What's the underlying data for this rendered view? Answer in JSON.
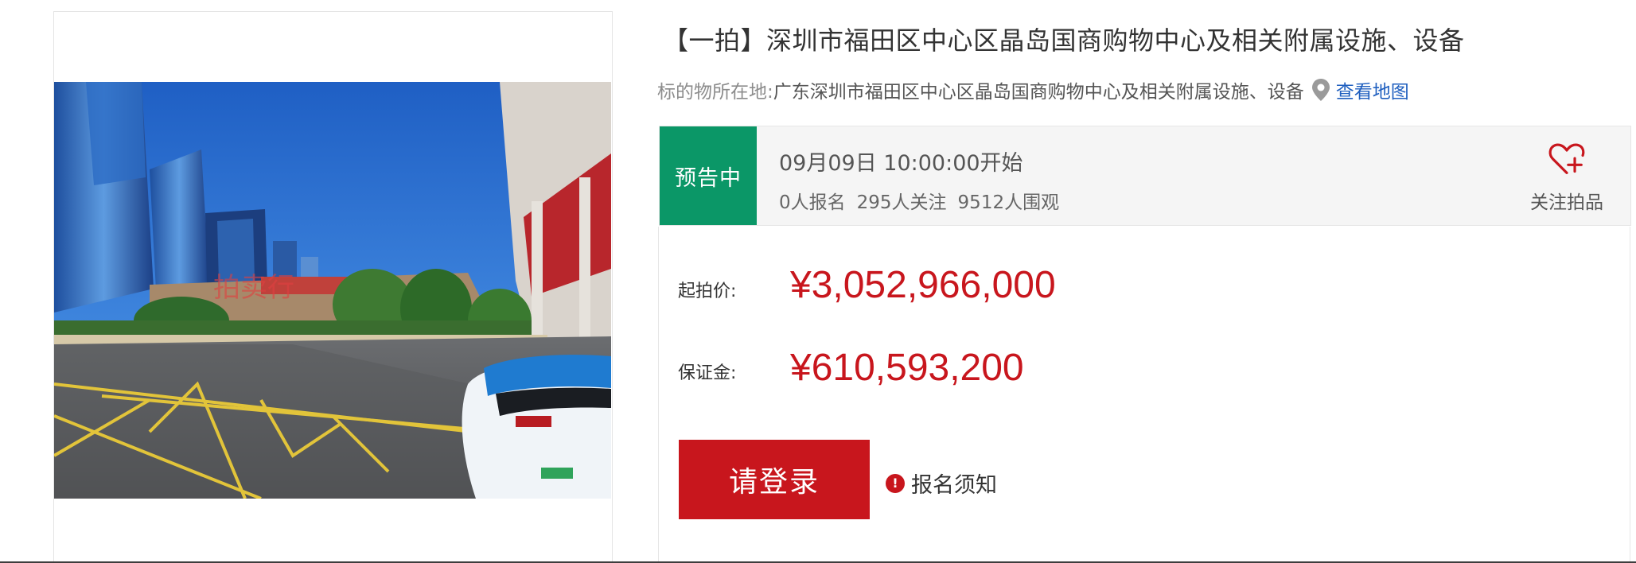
{
  "listing": {
    "title": "【一拍】深圳市福田区中心区晶岛国商购物中心及相关附属设施、设备",
    "location_label": "标的物所在地:",
    "location_value": "广东深圳市福田区中心区晶岛国商购物中心及相关附属设施、设备",
    "map_link": "查看地图",
    "photo_watermark": "拍卖行"
  },
  "status": {
    "badge": "预告中",
    "start_time": "09月09日 10:00:00开始",
    "registered": "0人报名",
    "followers": "295人关注",
    "viewers": "9512人围观",
    "follow_label": "关注拍品"
  },
  "pricing": {
    "starting_price_label": "起拍价:",
    "starting_price": "¥3,052,966,000",
    "deposit_label": "保证金:",
    "deposit": "¥610,593,200"
  },
  "actions": {
    "login_label": "请登录",
    "notice_label": "报名须知"
  },
  "colors": {
    "accent_red": "#c8161d",
    "status_green": "#0b9767",
    "link_blue": "#1f5fbf"
  },
  "icons": {
    "location": "map-pin-icon",
    "follow": "heart-plus-icon",
    "notice": "warning-icon"
  }
}
